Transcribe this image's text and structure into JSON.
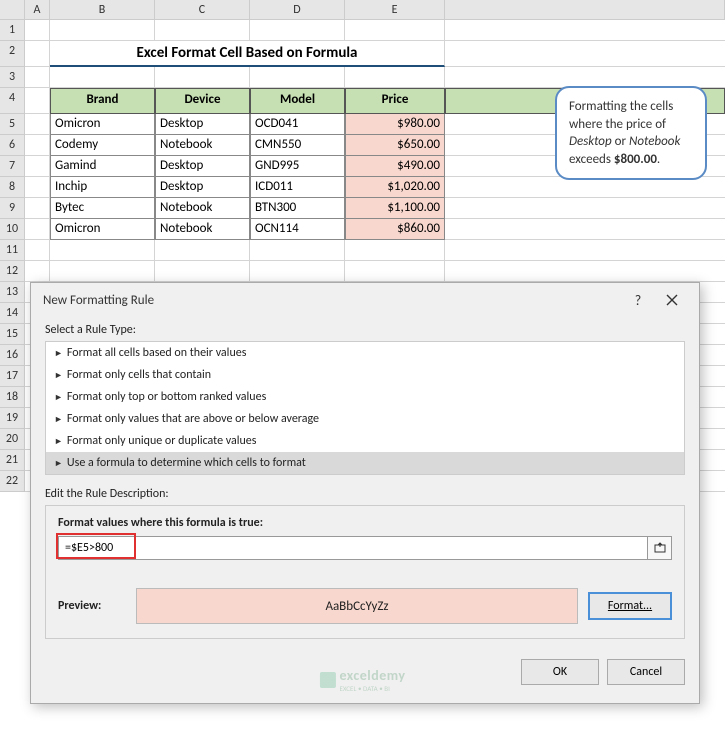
{
  "columns": [
    "A",
    "B",
    "C",
    "D",
    "E"
  ],
  "rows_visible": 22,
  "title": "Excel Format Cell Based on Formula",
  "table": {
    "headers": [
      "Brand",
      "Device",
      "Model",
      "Price"
    ],
    "rows": [
      [
        "Omicron",
        "Desktop",
        "OCD041",
        "$980.00"
      ],
      [
        "Codemy",
        "Notebook",
        "CMN550",
        "$650.00"
      ],
      [
        "Gamind",
        "Desktop",
        "GND995",
        "$490.00"
      ],
      [
        "Inchip",
        "Desktop",
        "ICD011",
        "$1,020.00"
      ],
      [
        "Bytec",
        "Notebook",
        "BTN300",
        "$1,100.00"
      ],
      [
        "Omicron",
        "Notebook",
        "OCN114",
        "$860.00"
      ]
    ]
  },
  "callout": {
    "text_pre": "Formatting the cells where the price of ",
    "em1": "Desktop",
    "mid": " or ",
    "em2": "Notebook",
    "text_post": " exceeds ",
    "bold": "$800.00",
    "tail": "."
  },
  "dialog": {
    "title": "New Formatting Rule",
    "help": "?",
    "select_label": "Select a Rule Type:",
    "rules": [
      "Format all cells based on their values",
      "Format only cells that contain",
      "Format only top or bottom ranked values",
      "Format only values that are above or below average",
      "Format only unique or duplicate values",
      "Use a formula to determine which cells to format"
    ],
    "selected_rule_index": 5,
    "edit_label": "Edit the Rule Description:",
    "formula_label": "Format values where this formula is true:",
    "formula_value": "=$E5>800",
    "preview_label": "Preview:",
    "preview_text": "AaBbCcYyZz",
    "format_btn": "Format...",
    "ok": "OK",
    "cancel": "Cancel"
  },
  "watermark": {
    "brand": "exceldemy",
    "tagline": "EXCEL • DATA • BI"
  }
}
